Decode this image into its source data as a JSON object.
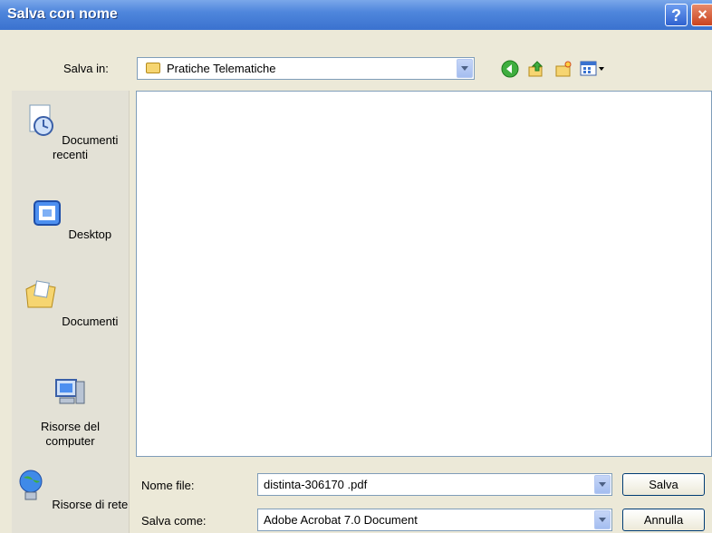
{
  "window": {
    "title": "Salva con nome",
    "help_label": "?",
    "close_label": "×"
  },
  "toolbar": {
    "save_in_label": "Salva in:",
    "save_in_value": "Pratiche Telematiche"
  },
  "places": [
    {
      "label": "Documenti recenti",
      "icon": "recent-documents-icon"
    },
    {
      "label": "Desktop",
      "icon": "desktop-icon"
    },
    {
      "label": "Documenti",
      "icon": "my-documents-icon"
    },
    {
      "label": "Risorse del computer",
      "icon": "my-computer-icon"
    },
    {
      "label": "Risorse di rete",
      "icon": "network-places-icon"
    }
  ],
  "form": {
    "filename_label": "Nome file:",
    "filename_value": "distinta-306170 .pdf",
    "savetype_label": "Salva come:",
    "savetype_value": "Adobe Acrobat 7.0 Document",
    "save_button": "Salva",
    "cancel_button": "Annulla"
  },
  "colors": {
    "titlebar": "#3a72cf",
    "dialog_bg": "#ece9d8",
    "input_border": "#7f9db9"
  }
}
